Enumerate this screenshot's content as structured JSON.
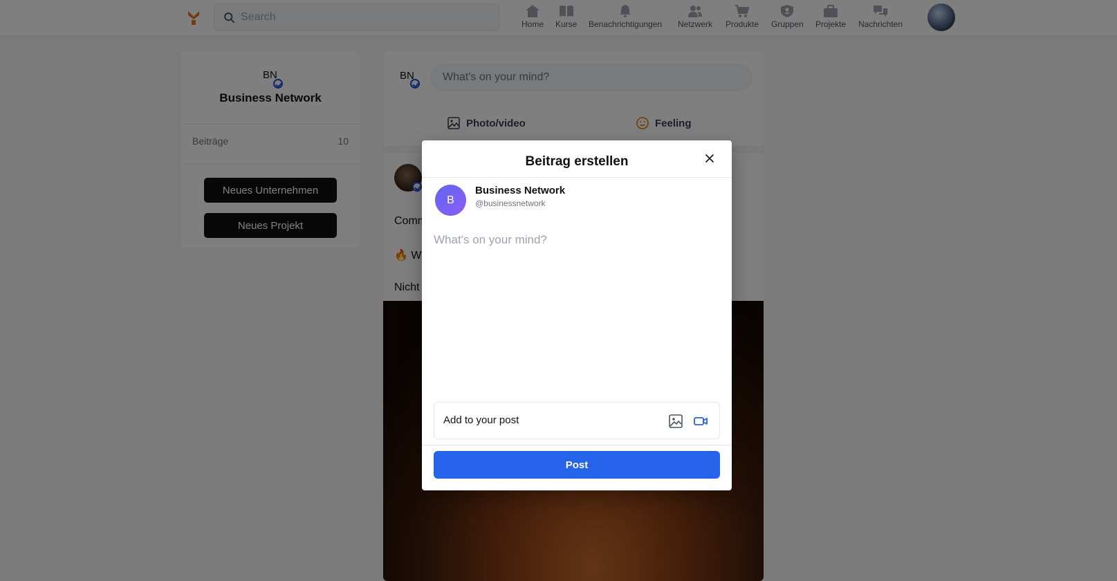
{
  "topbar": {
    "search_placeholder": "Search",
    "nav": [
      {
        "label": "Home",
        "icon": "home-icon"
      },
      {
        "label": "Kurse",
        "icon": "book-icon"
      },
      {
        "label": "Benachrichtigungen",
        "icon": "bell-icon"
      },
      {
        "label": "Netzwerk",
        "icon": "users-icon"
      },
      {
        "label": "Produkte",
        "icon": "cart-icon"
      },
      {
        "label": "Gruppen",
        "icon": "group-shield-icon"
      },
      {
        "label": "Projekte",
        "icon": "briefcase-icon"
      },
      {
        "label": "Nachrichten",
        "icon": "chat-icon"
      }
    ]
  },
  "sidebar": {
    "initials": "BN",
    "name": "Business Network",
    "stat_label": "Beiträge",
    "stat_value": "10",
    "buttons": {
      "new_company": "Neues Unternehmen",
      "new_project": "Neues Projekt"
    }
  },
  "composer": {
    "initials": "BN",
    "placeholder": "What's on your mind?",
    "photo_label": "Photo/video",
    "feeling_label": "Feeling"
  },
  "post": {
    "line1": "Comm",
    "line2": "🔥 W",
    "line3": "Nicht"
  },
  "modal": {
    "title": "Beitrag erstellen",
    "avatar_letter": "B",
    "account_name": "Business Network",
    "account_handle": "@businessnetwork",
    "textarea_placeholder": "What's on your mind?",
    "add_to_post": "Add to your post",
    "post_button": "Post"
  },
  "colors": {
    "primary": "#2563eb",
    "avatar_gradient_start": "#6366f1",
    "avatar_gradient_end": "#8b5cf6",
    "verified": "#1d4ed8"
  }
}
